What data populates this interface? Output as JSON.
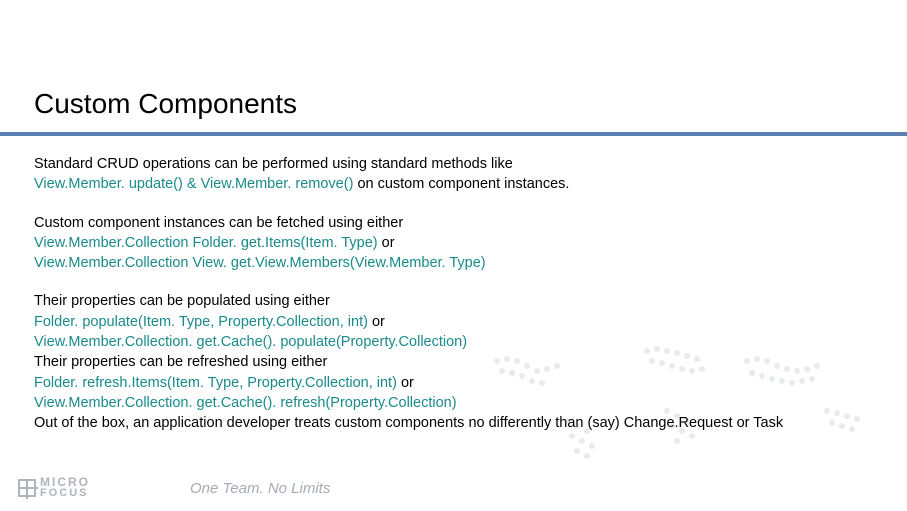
{
  "title": "Custom Components",
  "para1": {
    "a": "Standard CRUD operations can be performed using standard methods like",
    "b": "View.Member. update() & View.Member. remove() ",
    "c": "on custom component instances."
  },
  "para2": {
    "a": "Custom component instances can be fetched using either",
    "b": "View.Member.Collection Folder. get.Items(Item. Type) ",
    "c": "or",
    "d": "View.Member.Collection View. get.View.Members(View.Member. Type)"
  },
  "para3": {
    "a": "Their properties can be populated using either",
    "b": "Folder. populate(Item. Type, Property.Collection, int) ",
    "c": "or",
    "d": "View.Member.Collection. get.Cache(). populate(Property.Collection)",
    "e": "Their properties can be refreshed using either",
    "f": "Folder. refresh.Items(Item. Type, Property.Collection, int) ",
    "g": "or",
    "h": "View.Member.Collection. get.Cache(). refresh(Property.Collection)",
    "i": "Out of the box, an application developer treats custom components no differently than (say) Change.Request or Task"
  },
  "logo": {
    "line1": "MICRO",
    "line2": "FOCUS"
  },
  "tagline": "One Team. No Limits"
}
